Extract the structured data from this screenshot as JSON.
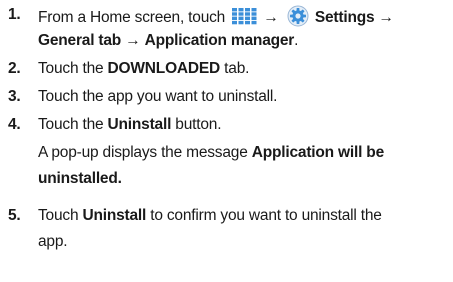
{
  "steps": [
    {
      "number": "1.",
      "line1": {
        "prefix": "From a Home screen, touch",
        "arrow1": "→",
        "settings": "Settings",
        "arrow2": "→"
      },
      "line2": {
        "general_tab": "General tab",
        "arrow": "→",
        "app_manager": "Application manager",
        "period": "."
      }
    },
    {
      "number": "2.",
      "prefix": "Touch the",
      "bold": "DOWNLOADED",
      "suffix": "tab."
    },
    {
      "number": "3.",
      "text": "Touch the app you want to uninstall."
    },
    {
      "number": "4.",
      "prefix": "Touch the",
      "bold": "Uninstall",
      "suffix": "button.",
      "note_prefix": "A pop-up displays the message",
      "note_bold_line1": "Application will be",
      "note_bold_line2": "uninstalled."
    },
    {
      "number": "5.",
      "prefix": "Touch",
      "bold": "Uninstall",
      "suffix": "to confirm you want to uninstall the",
      "line2": "app."
    }
  ],
  "icons": {
    "apps": "apps-grid-icon",
    "settings": "settings-gear-icon"
  },
  "colors": {
    "text": "#1a1a1a",
    "icon_blue": "#3b8fd9"
  }
}
